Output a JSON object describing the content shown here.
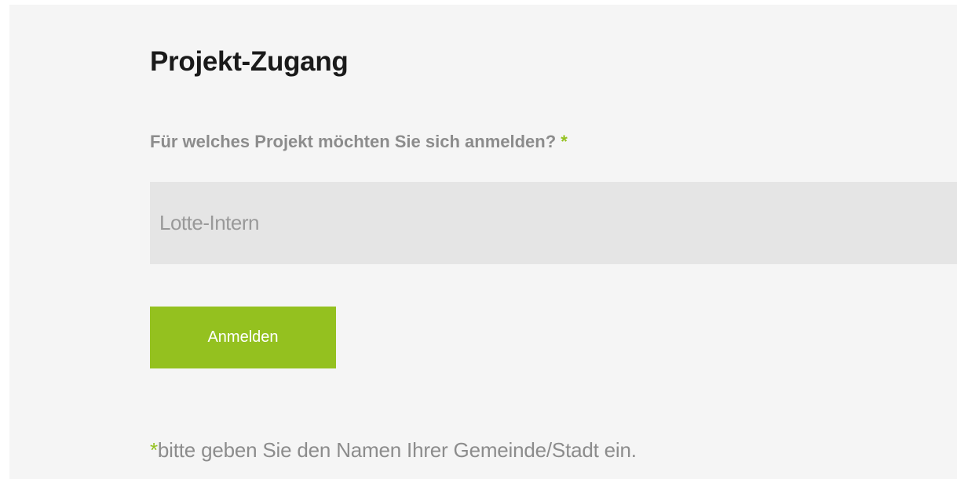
{
  "form": {
    "title": "Projekt-Zugang",
    "question_label": "Für welches Projekt möchten Sie sich anmelden?",
    "required_marker": "*",
    "project_input_value": "Lotte-Intern",
    "submit_label": "Anmelden",
    "footnote_marker": "*",
    "footnote_text": "bitte geben Sie den Namen Ihrer Gemeinde/Stadt ein."
  },
  "colors": {
    "accent": "#94c11f",
    "panel_background": "#f5f5f5",
    "input_background": "#e5e5e5",
    "label_text": "#8c8c8c",
    "title_text": "#1a1a1a"
  }
}
